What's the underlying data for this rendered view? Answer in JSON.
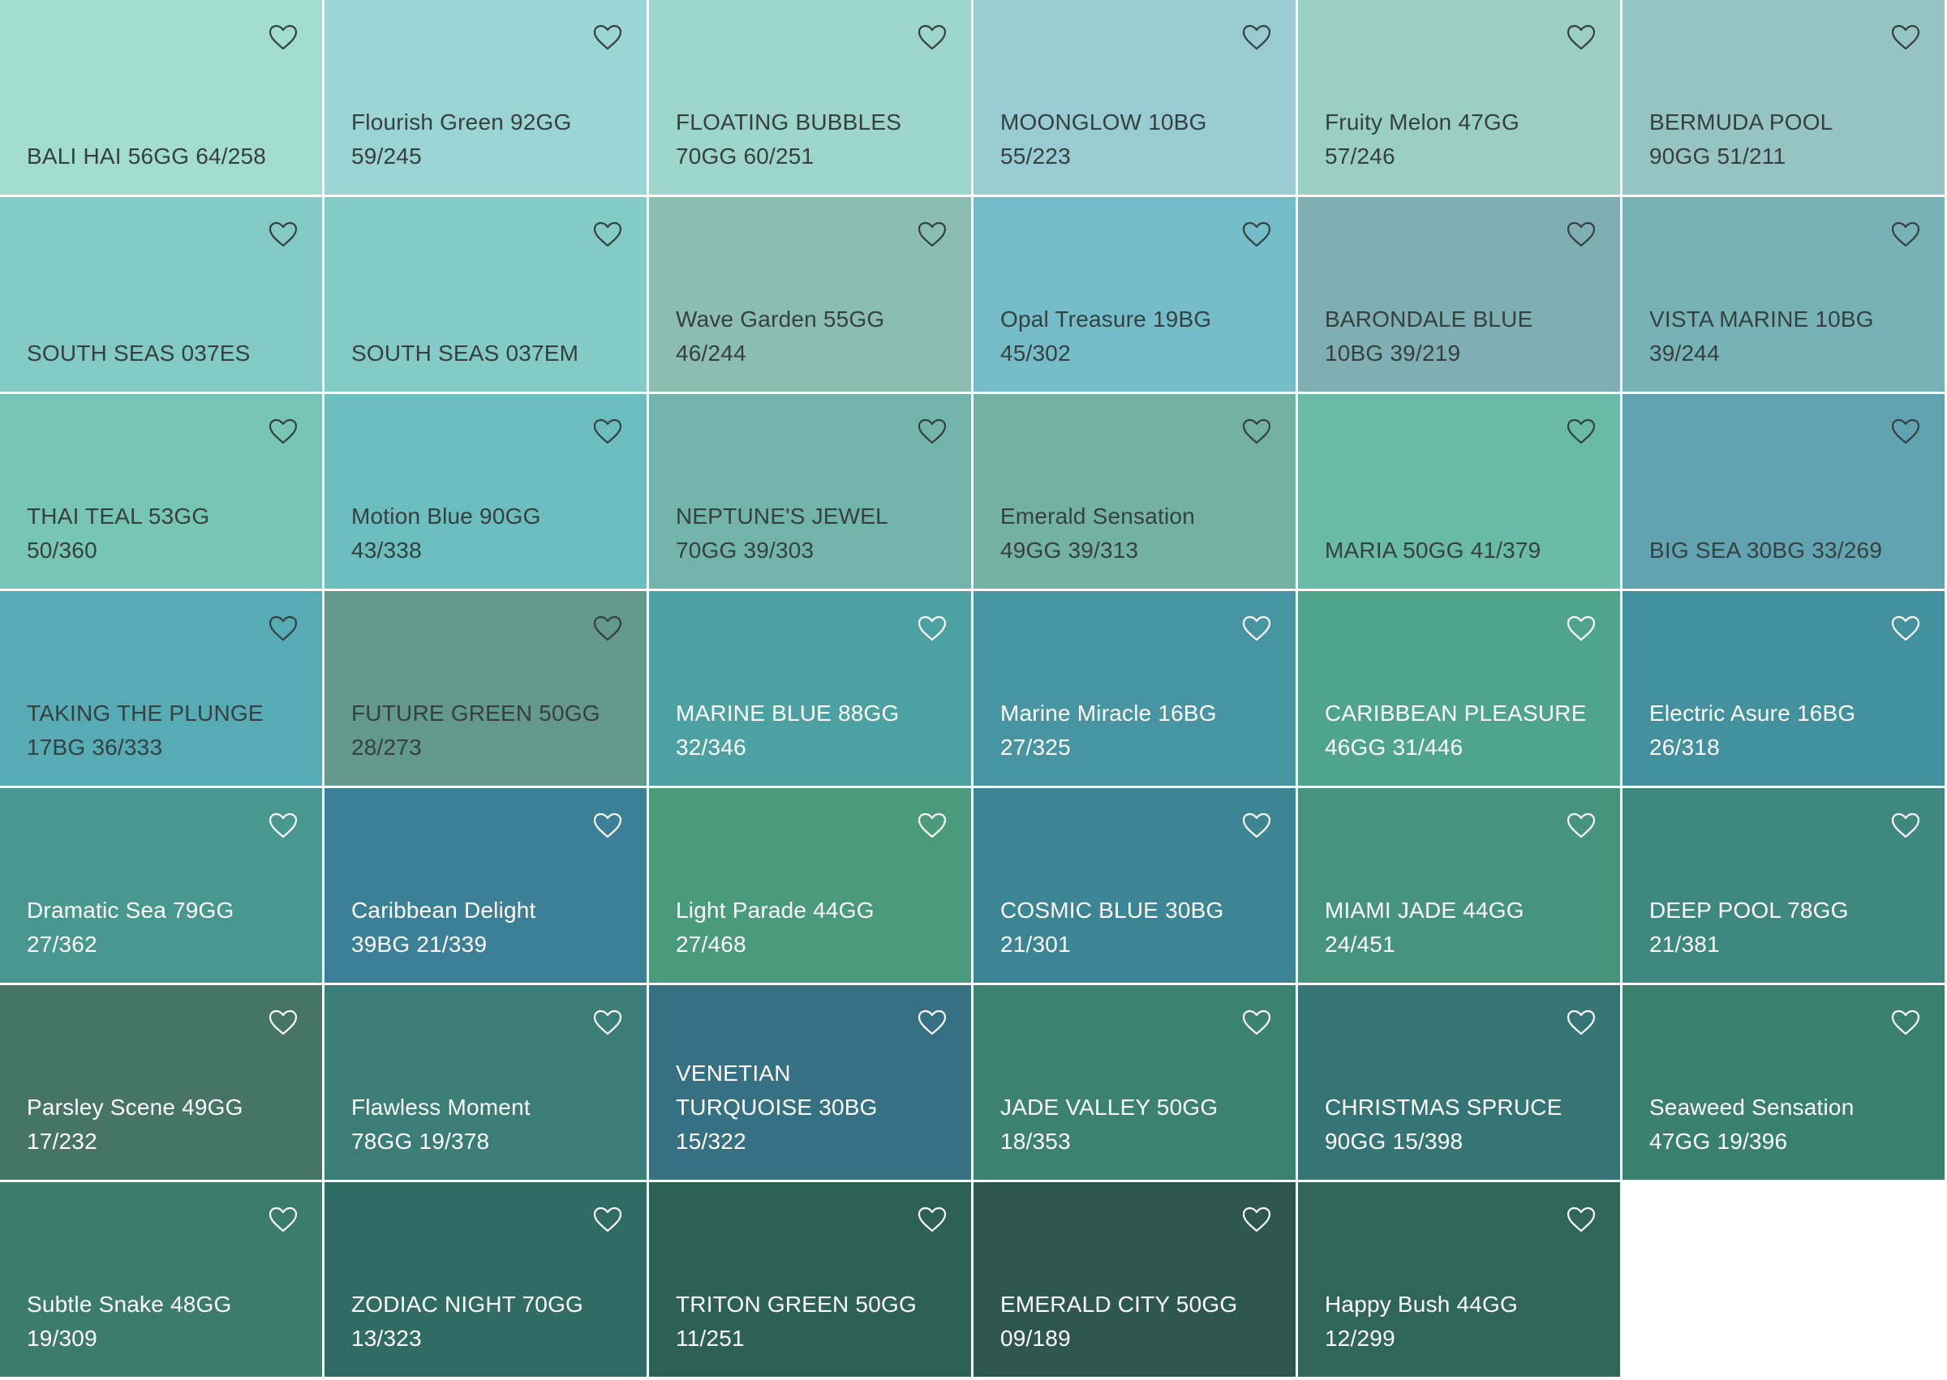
{
  "swatches": [
    {
      "line1": "BALI HAI 56GG 64/258",
      "line2": "",
      "line3": "",
      "color": "#a3ddd0",
      "text": "dark"
    },
    {
      "line1": "Flourish Green 92GG",
      "line2": "59/245",
      "line3": "",
      "color": "#9bd5d3",
      "text": "dark"
    },
    {
      "line1": "FLOATING BUBBLES",
      "line2": "70GG 60/251",
      "line3": "",
      "color": "#9dd4cc",
      "text": "dark"
    },
    {
      "line1": "MOONGLOW 10BG",
      "line2": "55/223",
      "line3": "",
      "color": "#99cbd2",
      "text": "dark"
    },
    {
      "line1": "Fruity Melon 47GG",
      "line2": "57/246",
      "line3": "",
      "color": "#9bcfc1",
      "text": "dark"
    },
    {
      "line1": "BERMUDA POOL",
      "line2": "90GG 51/211",
      "line3": "",
      "color": "#96c4c3",
      "text": "dark"
    },
    {
      "line1": "SOUTH SEAS 037ES",
      "line2": "",
      "line3": "",
      "color": "#83cac4",
      "text": "dark"
    },
    {
      "line1": "SOUTH SEAS 037EM",
      "line2": "",
      "line3": "",
      "color": "#84cbc5",
      "text": "dark"
    },
    {
      "line1": "Wave Garden 55GG",
      "line2": "46/244",
      "line3": "",
      "color": "#8bbdb0",
      "text": "dark"
    },
    {
      "line1": "Opal Treasure 19BG",
      "line2": "45/302",
      "line3": "",
      "color": "#74bdc8",
      "text": "dark"
    },
    {
      "line1": "BARONDALE BLUE",
      "line2": "10BG 39/219",
      "line3": "",
      "color": "#7fafb2",
      "text": "dark"
    },
    {
      "line1": "VISTA MARINE 10BG",
      "line2": "39/244",
      "line3": "",
      "color": "#77b2b6",
      "text": "dark"
    },
    {
      "line1": "THAI TEAL 53GG",
      "line2": "50/360",
      "line3": "",
      "color": "#77c5b5",
      "text": "dark"
    },
    {
      "line1": "Motion Blue 90GG",
      "line2": "43/338",
      "line3": "",
      "color": "#6bbdbe",
      "text": "dark"
    },
    {
      "line1": "NEPTUNE'S JEWEL",
      "line2": "70GG 39/303",
      "line3": "",
      "color": "#72b4aa",
      "text": "dark"
    },
    {
      "line1": "Emerald Sensation",
      "line2": "49GG 39/313",
      "line3": "",
      "color": "#73b2a1",
      "text": "dark"
    },
    {
      "line1": "MARIA 50GG 41/379",
      "line2": "",
      "line3": "",
      "color": "#6abaa8",
      "text": "dark"
    },
    {
      "line1": "BIG SEA 30BG 33/269",
      "line2": "",
      "line3": "",
      "color": "#62a3b2",
      "text": "dark"
    },
    {
      "line1": "TAKING THE PLUNGE",
      "line2": "17BG 36/333",
      "line3": "",
      "color": "#57abb5",
      "text": "dark"
    },
    {
      "line1": "FUTURE GREEN 50GG",
      "line2": "28/273",
      "line3": "",
      "color": "#639988",
      "text": "dark"
    },
    {
      "line1": "MARINE BLUE 88GG",
      "line2": "32/346",
      "line3": "",
      "color": "#4ca1a2",
      "text": "light"
    },
    {
      "line1": "Marine Miracle 16BG",
      "line2": "27/325",
      "line3": "",
      "color": "#4794a3",
      "text": "light"
    },
    {
      "line1": "CARIBBEAN PLEASURE",
      "line2": "46GG 31/446",
      "line3": "",
      "color": "#4ea58a",
      "text": "light"
    },
    {
      "line1": "Electric Asure 16BG",
      "line2": "26/318",
      "line3": "",
      "color": "#43909e",
      "text": "light"
    },
    {
      "line1": "Dramatic Sea 79GG",
      "line2": "27/362",
      "line3": "",
      "color": "#489890",
      "text": "light"
    },
    {
      "line1": "Caribbean Delight",
      "line2": "39BG 21/339",
      "line3": "",
      "color": "#3c8097",
      "text": "light"
    },
    {
      "line1": "Light Parade 44GG",
      "line2": "27/468",
      "line3": "",
      "color": "#4a9a7e",
      "text": "light"
    },
    {
      "line1": "COSMIC BLUE 30BG",
      "line2": "21/301",
      "line3": "",
      "color": "#3c8595",
      "text": "light"
    },
    {
      "line1": "MIAMI JADE 44GG",
      "line2": "24/451",
      "line3": "",
      "color": "#46947b",
      "text": "light"
    },
    {
      "line1": "DEEP POOL 78GG",
      "line2": "21/381",
      "line3": "",
      "color": "#3e887f",
      "text": "light"
    },
    {
      "line1": "Parsley Scene 49GG",
      "line2": "17/232",
      "line3": "",
      "color": "#477565",
      "text": "light"
    },
    {
      "line1": "Flawless Moment",
      "line2": "78GG 19/378",
      "line3": "",
      "color": "#3a7e77",
      "text": "light"
    },
    {
      "line1": "VENETIAN",
      "line2": "TURQUOISE 30BG",
      "line3": "15/322",
      "color": "#357182",
      "text": "light"
    },
    {
      "line1": "JADE VALLEY 50GG",
      "line2": "18/353",
      "line3": "",
      "color": "#3b826f",
      "text": "light"
    },
    {
      "line1": "CHRISTMAS SPRUCE",
      "line2": "90GG 15/398",
      "line3": "",
      "color": "#367576",
      "text": "light"
    },
    {
      "line1": "Seaweed Sensation",
      "line2": "47GG 19/396",
      "line3": "",
      "color": "#39806d",
      "text": "light"
    },
    {
      "line1": "Subtle Snake 48GG",
      "line2": "19/309",
      "line3": "",
      "color": "#3b7c6c",
      "text": "light"
    },
    {
      "line1": "ZODIAC NIGHT 70GG",
      "line2": "13/323",
      "line3": "",
      "color": "#306c64",
      "text": "light"
    },
    {
      "line1": "TRITON GREEN 50GG",
      "line2": "11/251",
      "line3": "",
      "color": "#2d6154",
      "text": "light"
    },
    {
      "line1": "EMERALD CITY 50GG",
      "line2": "09/189",
      "line3": "",
      "color": "#2e5750",
      "text": "light"
    },
    {
      "line1": "Happy Bush 44GG",
      "line2": "12/299",
      "line3": "",
      "color": "#2f6658",
      "text": "light"
    }
  ]
}
